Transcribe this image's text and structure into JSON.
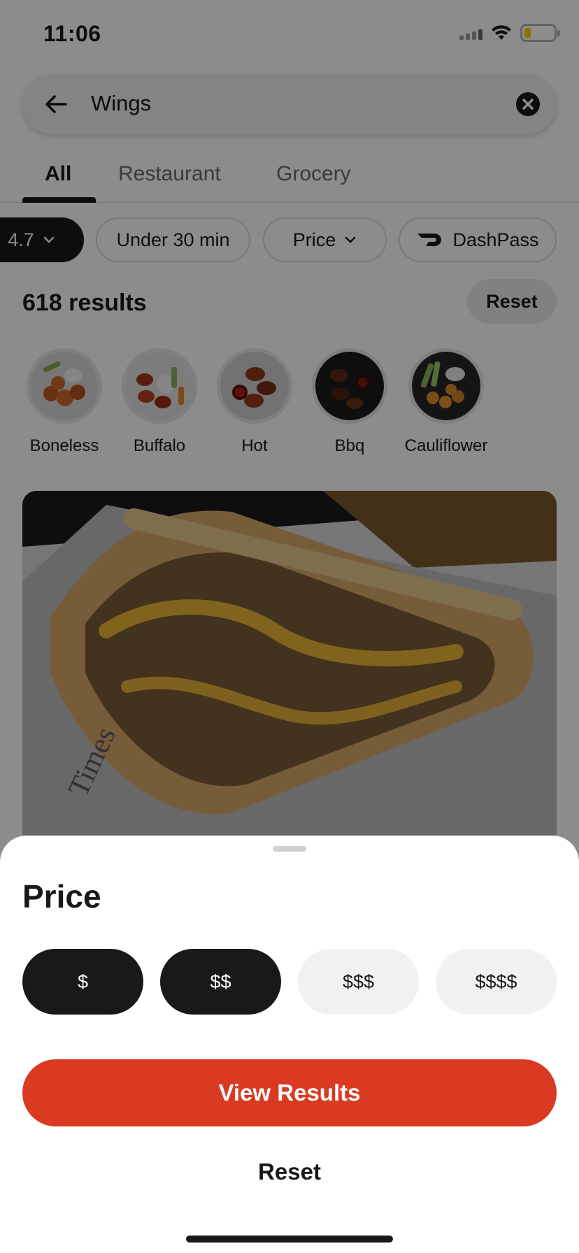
{
  "status_bar": {
    "time": "11:06",
    "battery_color": "#f1d500"
  },
  "search": {
    "query": "Wings",
    "back_icon": "arrow-left-icon",
    "clear_icon": "close-circle-icon"
  },
  "tabs": [
    {
      "label": "All",
      "active": true
    },
    {
      "label": "Restaurant",
      "active": false
    },
    {
      "label": "Grocery",
      "active": false
    }
  ],
  "filters": {
    "rating": "4.7",
    "under_30": "Under 30 min",
    "price": "Price",
    "dashpass": "DashPass"
  },
  "results": {
    "count_label": "618 results",
    "reset_label": "Reset"
  },
  "categories": [
    {
      "label": "Boneless"
    },
    {
      "label": "Buffalo"
    },
    {
      "label": "Hot"
    },
    {
      "label": "Bbq"
    },
    {
      "label": "Cauliflower"
    }
  ],
  "sheet": {
    "title": "Price",
    "options": [
      {
        "label": "$",
        "selected": true
      },
      {
        "label": "$$",
        "selected": true
      },
      {
        "label": "$$$",
        "selected": false
      },
      {
        "label": "$$$$",
        "selected": false
      }
    ],
    "view_results_label": "View Results",
    "reset_label": "Reset"
  },
  "colors": {
    "accent": "#d93a21",
    "selected": "#191919",
    "unselected": "#f1f1f1"
  }
}
